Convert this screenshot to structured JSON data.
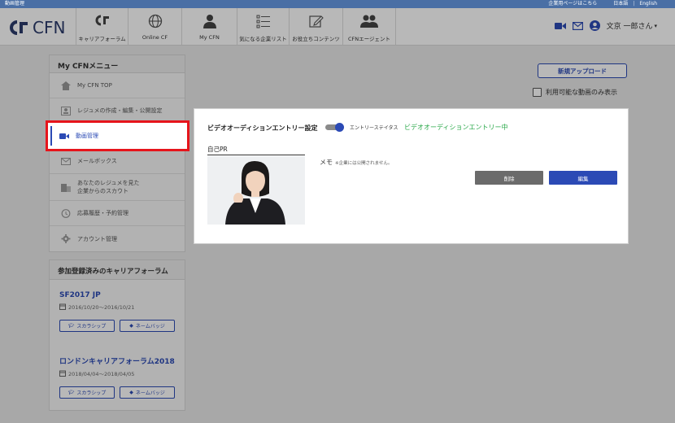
{
  "topstrip": {
    "page_label": "動画管理",
    "company_link": "企業用ページはこちら",
    "lang_ja": "日本語",
    "lang_sep": "|",
    "lang_en": "English"
  },
  "header": {
    "logo_text": "CFN",
    "nav": [
      {
        "label": "キャリアフォーラム",
        "icon": "cf-logo-icon"
      },
      {
        "label": "Online CF",
        "icon": "globe-icon"
      },
      {
        "label": "My CFN",
        "icon": "person-icon"
      },
      {
        "label": "気になる企業リスト",
        "icon": "list-icon"
      },
      {
        "label": "お役立ちコンテンツ",
        "icon": "pencil-icon"
      },
      {
        "label": "CFNエージェント",
        "icon": "people-icon"
      }
    ],
    "user_name": "文京 一郎さん"
  },
  "sidebar": {
    "title": "My CFNメニュー",
    "items": [
      {
        "label": "My CFN TOP",
        "icon": "home-icon"
      },
      {
        "label": "レジュメの作成・編集・公開設定",
        "icon": "resume-icon"
      },
      {
        "label": "動画管理",
        "icon": "video-icon"
      },
      {
        "label": "メールボックス",
        "icon": "mail-icon"
      },
      {
        "label": "あなたのレジュメを見た",
        "label2": "企業からのスカウト",
        "icon": "building-icon"
      },
      {
        "label": "応募履歴・予約管理",
        "icon": "history-icon"
      },
      {
        "label": "アカウント管理",
        "icon": "gear-icon"
      }
    ]
  },
  "forums": {
    "title": "参加登録済みのキャリアフォーラム",
    "entries": [
      {
        "name": "SF2017 JP",
        "dates": "2016/10/20〜2016/10/21",
        "scholarship": "スカラシップ",
        "namebadge": "ネームバッジ"
      },
      {
        "name": "ロンドンキャリアフォーラム2018",
        "dates": "2018/04/04〜2018/04/05",
        "scholarship": "スカラシップ",
        "namebadge": "ネームバッジ"
      }
    ]
  },
  "main": {
    "upload_label": "新規アップロード",
    "only_available_label": "利用可能な動画のみ表示",
    "card": {
      "title": "ビデオオーディションエントリー設定",
      "status_label": "エントリーステイタス",
      "status_value": "ビデオオーディションエントリー中",
      "pr_label": "自己PR",
      "memo_label": "メモ",
      "memo_note": "※企業には公開されません。",
      "delete_label": "削除",
      "edit_label": "編集"
    }
  },
  "colors": {
    "accent": "#2b4ab5",
    "highlight": "#e6141b",
    "status_green": "#2aa84a"
  }
}
